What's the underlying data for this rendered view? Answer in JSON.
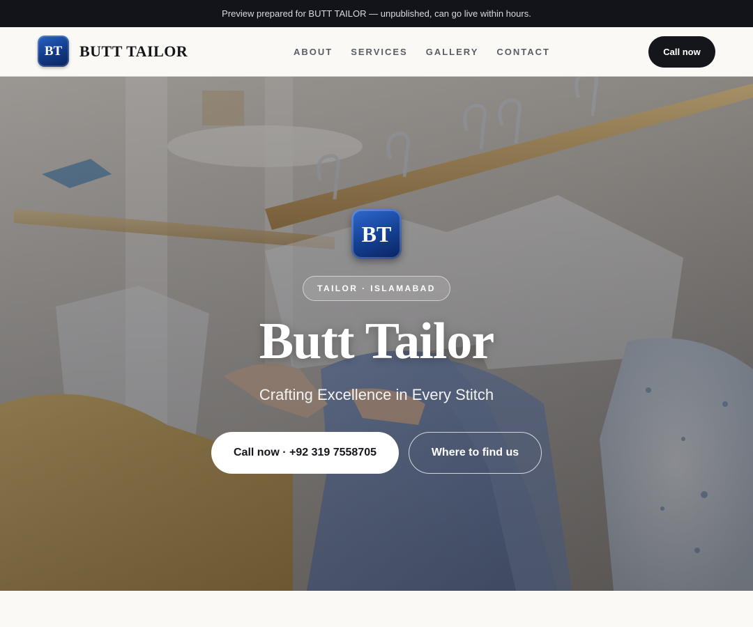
{
  "announcement": {
    "text": "Preview prepared for BUTT TAILOR — unpublished, can go live within hours."
  },
  "header": {
    "logo_initials": "BT",
    "brand_name": "BUTT TAILOR",
    "nav": [
      {
        "label": "ABOUT"
      },
      {
        "label": "SERVICES"
      },
      {
        "label": "GALLERY"
      },
      {
        "label": "CONTACT"
      }
    ],
    "cta_label": "Call now"
  },
  "hero": {
    "logo_initials": "BT",
    "pill": "TAILOR · ISLAMABAD",
    "title": "Butt Tailor",
    "subtitle": "Crafting Excellence in Every Stitch",
    "primary_button": "Call now · +92 319 7558705",
    "secondary_button": "Where to find us",
    "background_image": "clothes-rack-hangers-photo"
  },
  "colors": {
    "announcement_bg": "#12141a",
    "page_bg": "#faf9f6",
    "cta_bg": "#15161b",
    "logo_blue": "#143f92"
  }
}
